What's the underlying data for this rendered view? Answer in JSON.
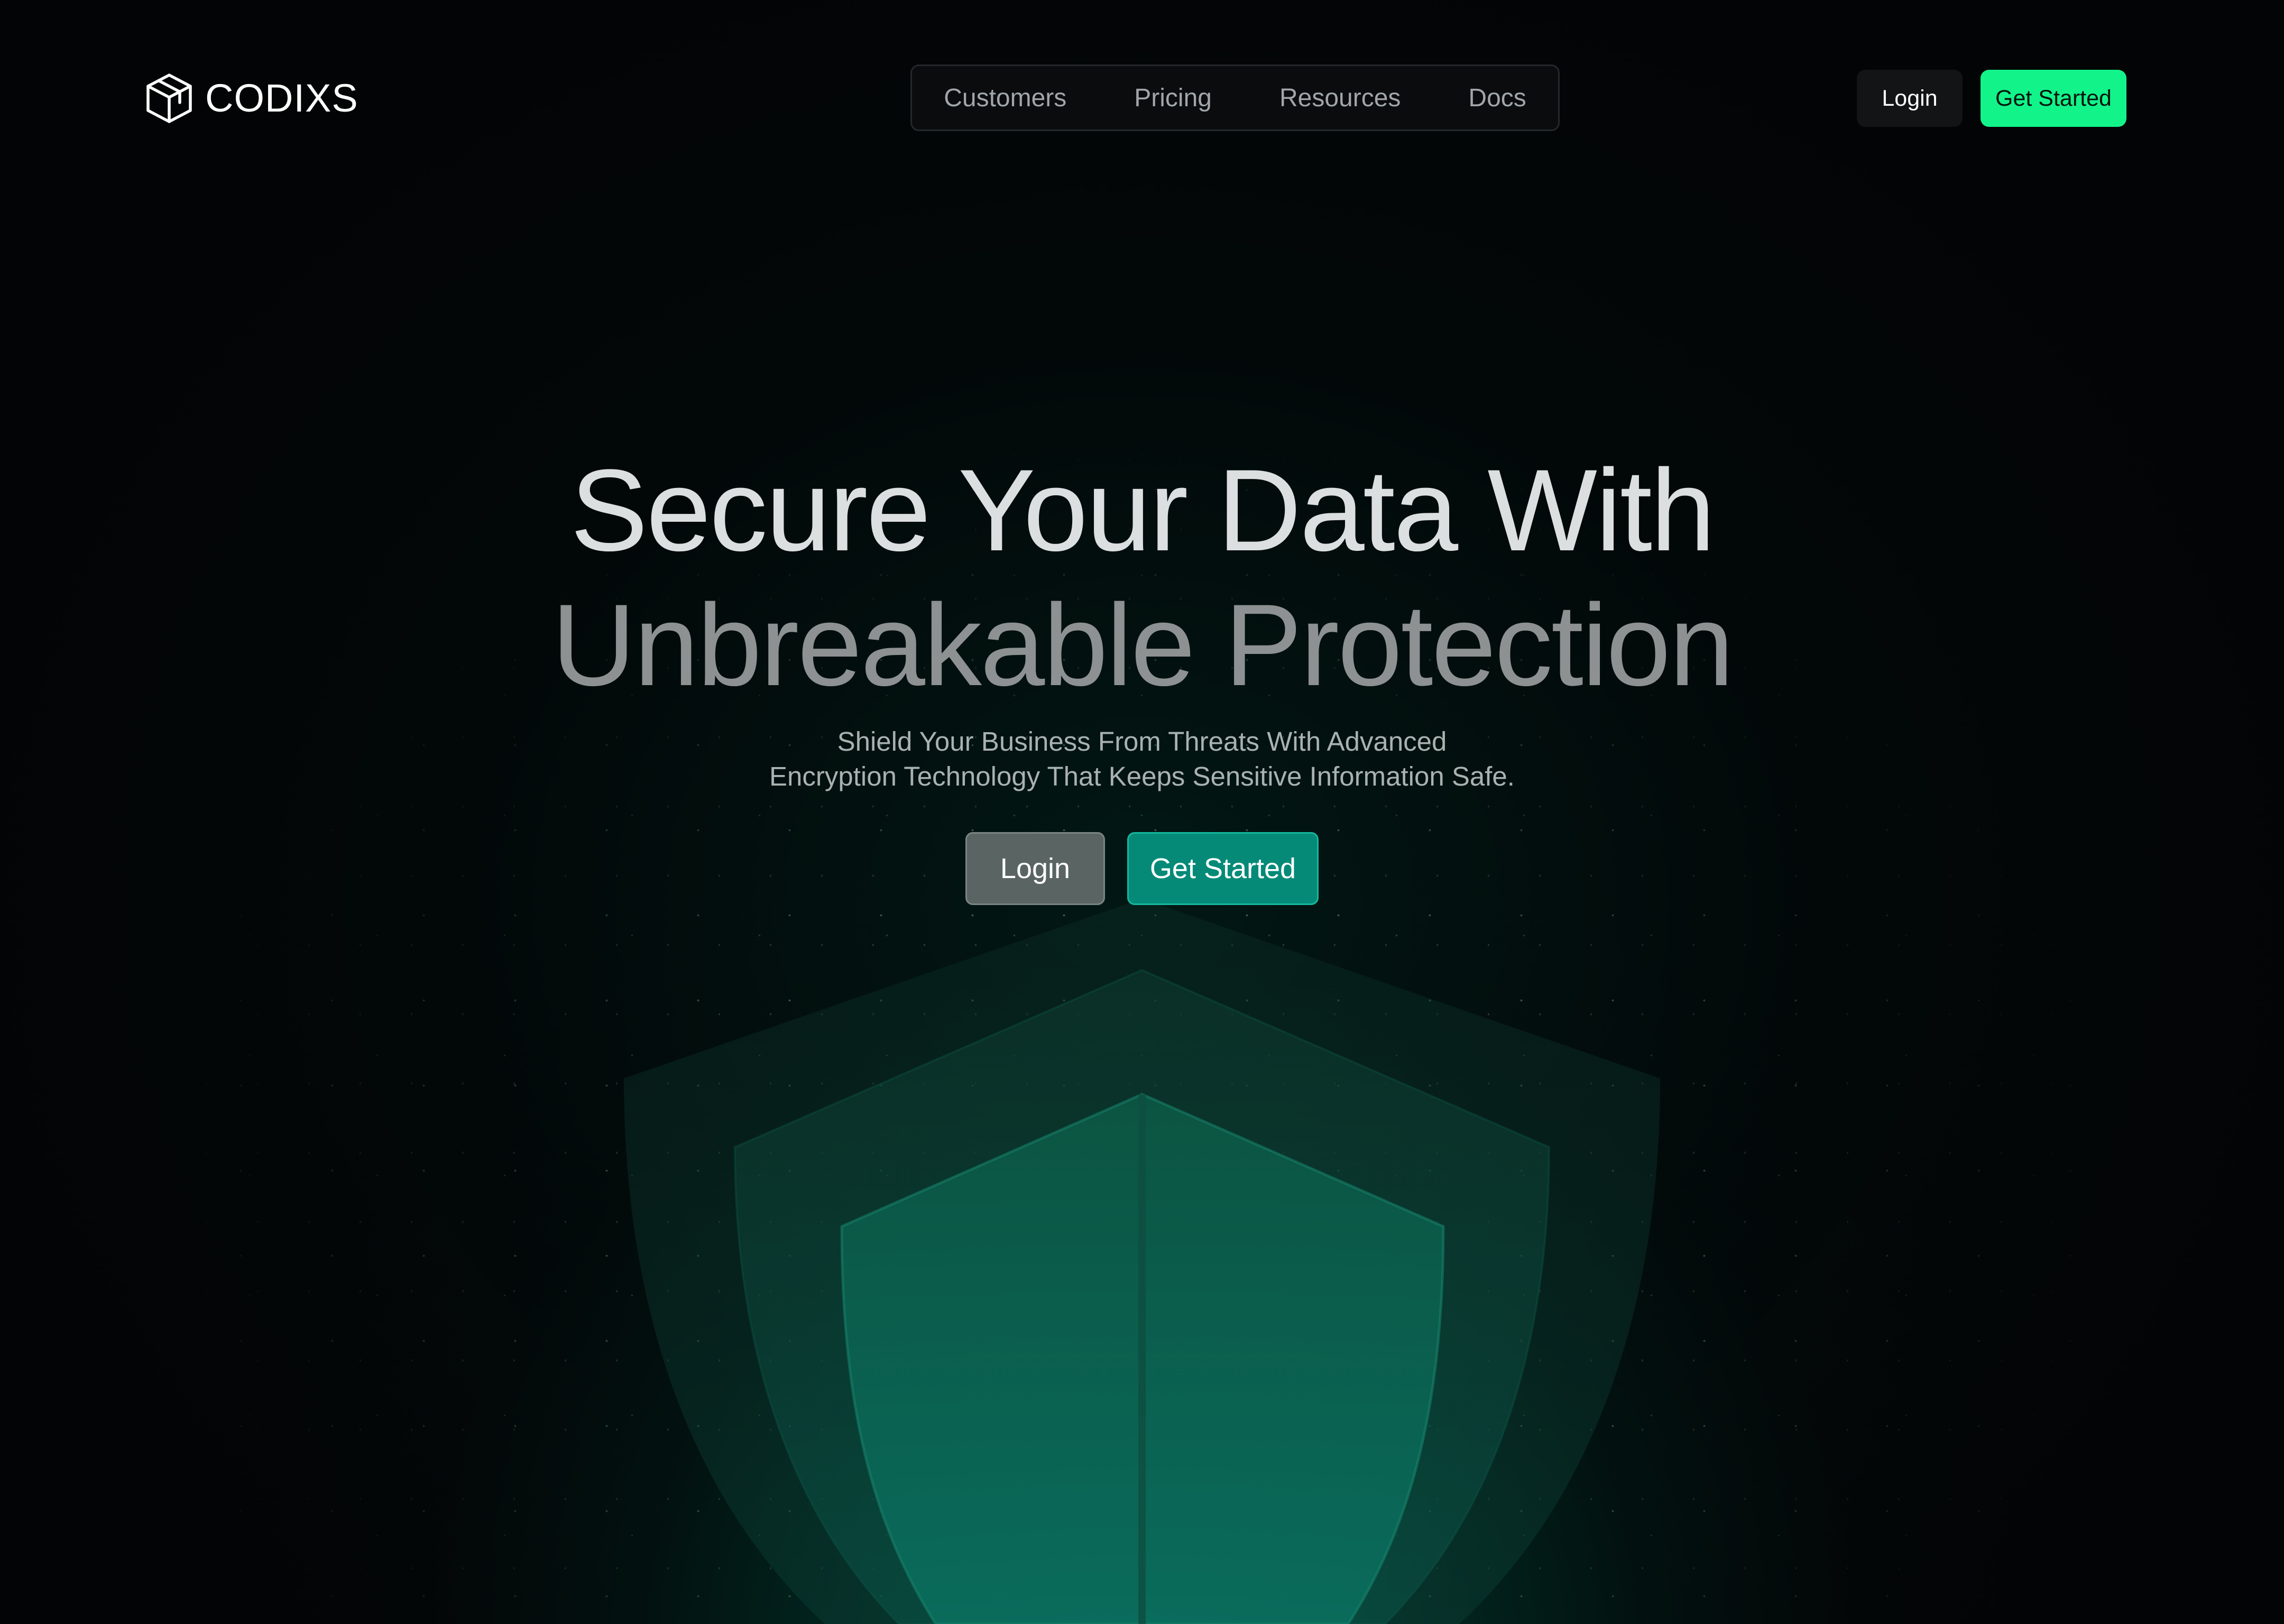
{
  "brand": {
    "name": "CODIXS",
    "logo_icon": "cube-icon"
  },
  "nav": {
    "items": [
      {
        "label": "Customers"
      },
      {
        "label": "Pricing"
      },
      {
        "label": "Resources"
      },
      {
        "label": "Docs"
      }
    ]
  },
  "header_actions": {
    "login_label": "Login",
    "get_started_label": "Get Started"
  },
  "hero": {
    "title_line1": "Secure Your Data With",
    "title_line2": "Unbreakable Protection",
    "subtitle_line1": "Shield Your Business From Threats With Advanced",
    "subtitle_line2": "Encryption Technology That Keeps Sensitive Information Safe.",
    "login_label": "Login",
    "get_started_label": "Get Started"
  },
  "illustration": {
    "icon": "shield-icon"
  },
  "colors": {
    "background": "#030405",
    "accent": "#12f48a",
    "teal_button": "#058a78",
    "shield_glow": "#0a6b55"
  }
}
